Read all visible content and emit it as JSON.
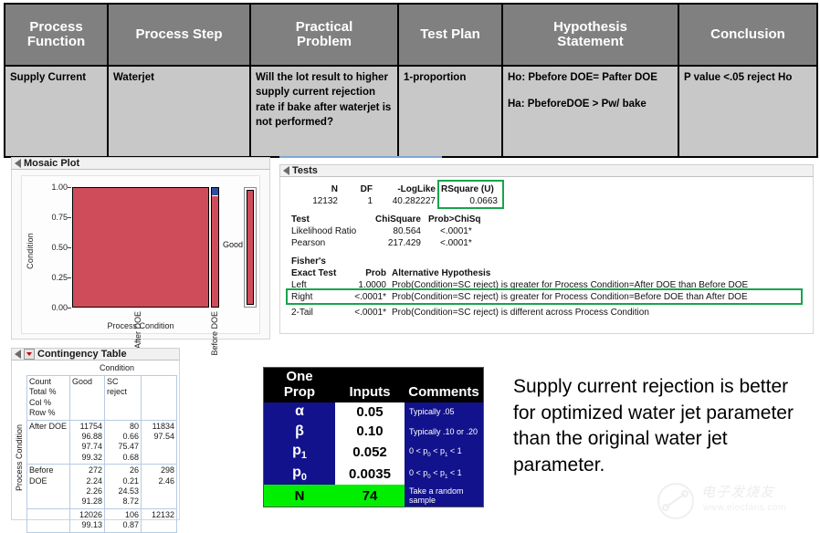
{
  "matrix": {
    "headers": [
      "Process\nFunction",
      "Process Step",
      "Practical\nProblem",
      "Test Plan",
      "Hypothesis\nStatement",
      "Conclusion"
    ],
    "header_1a": "Process",
    "header_1b": "Function",
    "header_2": "Process Step",
    "header_3a": "Practical",
    "header_3b": "Problem",
    "header_4": "Test Plan",
    "header_5a": "Hypothesis",
    "header_5b": "Statement",
    "header_6": "Conclusion",
    "row": {
      "process_function": "Supply Current",
      "process_step": "Waterjet",
      "practical_problem": "Will the lot result to higher  supply current rejection rate if bake after waterjet is not performed?",
      "test_plan": "1-proportion",
      "hypothesis_null": "Ho: Pbefore DOE= Pafter DOE",
      "hypothesis_alt": "Ha: PbeforeDOE > Pw/ bake",
      "conclusion": "P value <.05 reject Ho"
    }
  },
  "mosaic": {
    "title": "Mosaic Plot",
    "y_axis_label": "Condition",
    "x_axis_label": "Process Condition",
    "y_ticks": [
      "1.00",
      "0.75",
      "0.50",
      "0.25",
      "0.00"
    ],
    "x_ticks": [
      "After DOE",
      "Before DOE"
    ],
    "legend_label": "Good"
  },
  "tests": {
    "title": "Tests",
    "summary_headers": [
      "N",
      "DF",
      "-LogLike",
      "RSquare (U)"
    ],
    "summary_values": [
      "12132",
      "1",
      "40.282227",
      "0.0663"
    ],
    "test_headers": [
      "Test",
      "ChiSquare",
      "Prob>ChiSq"
    ],
    "test_rows": [
      {
        "name": "Likelihood Ratio",
        "chisquare": "80.564",
        "prob": "<.0001*"
      },
      {
        "name": "Pearson",
        "chisquare": "217.429",
        "prob": "<.0001*"
      }
    ],
    "fishers_title_line1": "Fisher's",
    "fishers_title_line2": "Exact Test",
    "fishers_headers": [
      "Prob",
      "Alternative Hypothesis"
    ],
    "fishers_rows": [
      {
        "side": "Left",
        "prob": "1.0000",
        "alt": "Prob(Condition=SC reject) is greater for Process Condition=After DOE than Before DOE"
      },
      {
        "side": "Right",
        "prob": "<.0001*",
        "alt": "Prob(Condition=SC reject) is greater for Process Condition=Before DOE than After DOE"
      },
      {
        "side": "2-Tail",
        "prob": "<.0001*",
        "alt": "Prob(Condition=SC reject) is different across Process Condition"
      }
    ],
    "highlight_color": "#17a44a"
  },
  "contingency": {
    "title": "Contingency Table",
    "column_group_label": "Condition",
    "row_group_label": "Process Condition",
    "legend_keys": [
      "Count",
      "Total %",
      "Col %",
      "Row %"
    ],
    "col_headers": [
      "Good",
      "SC reject"
    ],
    "rows": [
      {
        "label": "After DOE",
        "good": [
          "11754",
          "96.88",
          "97.74",
          "99.32"
        ],
        "sc_reject": [
          "80",
          "0.66",
          "75.47",
          "0.68"
        ],
        "total": [
          "11834",
          "97.54"
        ]
      },
      {
        "label": "Before DOE",
        "good": [
          "272",
          "2.24",
          "2.26",
          "91.28"
        ],
        "sc_reject": [
          "26",
          "0.21",
          "24.53",
          "8.72"
        ],
        "total": [
          "298",
          "2.46"
        ]
      },
      {
        "label": "",
        "good": [
          "12026",
          "99.13"
        ],
        "sc_reject": [
          "106",
          "0.87"
        ],
        "total": [
          "12132"
        ]
      }
    ]
  },
  "one_prop": {
    "header_line1": "One",
    "header_line2": "Prop",
    "header_inputs": "Inputs",
    "header_comments": "Comments",
    "rows": [
      {
        "symbol": "α",
        "symbol_sub": "",
        "value": "0.05",
        "comment": "Typically .05"
      },
      {
        "symbol": "β",
        "symbol_sub": "",
        "value": "0.10",
        "comment": "Typically .10 or .20"
      },
      {
        "symbol": "p",
        "symbol_sub": "1",
        "value": "0.052",
        "comment": "0 < p0 < p1 < 1"
      },
      {
        "symbol": "p",
        "symbol_sub": "0",
        "value": "0.0035",
        "comment": "0 < p0 < p1 < 1"
      },
      {
        "symbol": "N",
        "symbol_sub": "",
        "value": "74",
        "comment": "Take a random sample"
      }
    ],
    "header_bg": "#000000",
    "row_bg": "#12128c",
    "value_bg": "#ffffff",
    "n_row_bg": "#00ef00"
  },
  "conclusion_text": "Supply current rejection is better for optimized water jet parameter  than the original water jet parameter.",
  "watermark": {
    "text": "电子发烧友",
    "url": "www.elecfans.com"
  }
}
